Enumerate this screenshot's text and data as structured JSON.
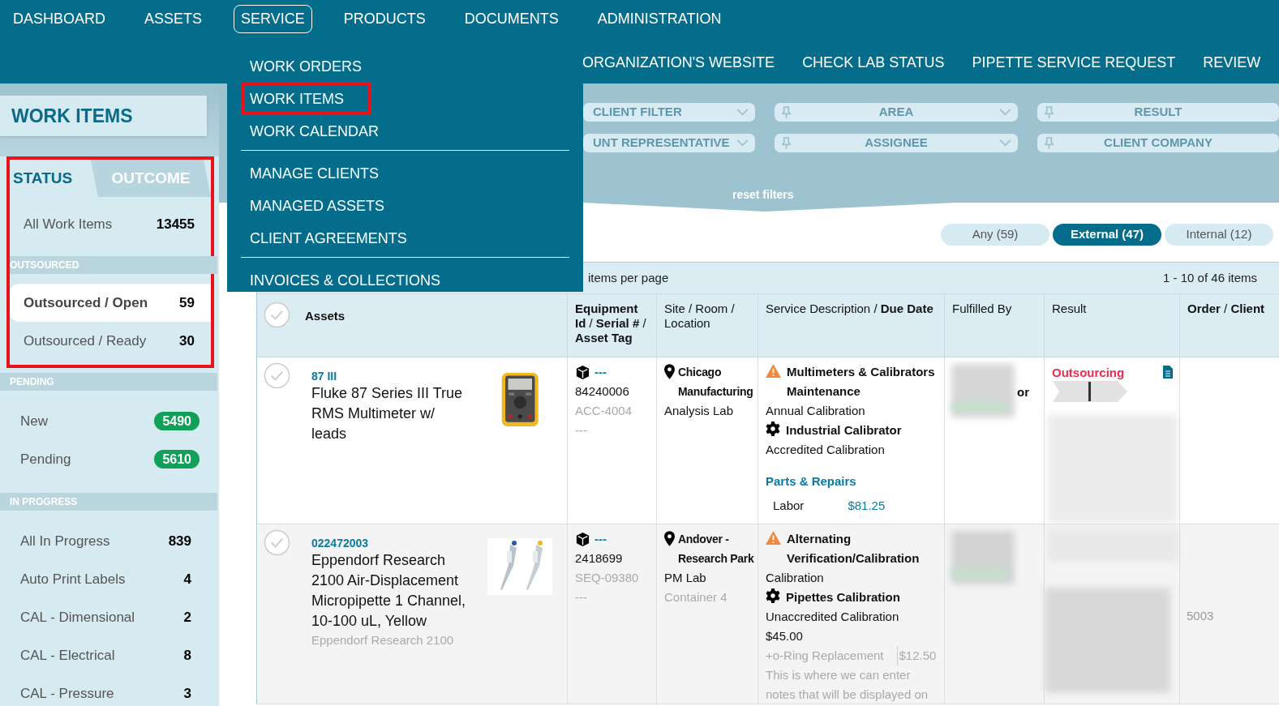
{
  "top_nav": [
    {
      "label": "DASHBOARD",
      "selected": false
    },
    {
      "label": "ASSETS",
      "selected": false
    },
    {
      "label": "SERVICE",
      "selected": true
    },
    {
      "label": "PRODUCTS",
      "selected": false
    },
    {
      "label": "DOCUMENTS",
      "selected": false
    },
    {
      "label": "ADMINISTRATION",
      "selected": false
    }
  ],
  "secondary_nav": [
    "ORGANIZATION'S WEBSITE",
    "CHECK LAB STATUS",
    "PIPETTE SERVICE REQUEST",
    "REVIEW"
  ],
  "service_menu": [
    {
      "items": [
        {
          "label": "WORK ORDERS",
          "highlighted": false
        },
        {
          "label": "WORK ITEMS",
          "highlighted": true
        },
        {
          "label": "WORK CALENDAR",
          "highlighted": false
        }
      ]
    },
    {
      "items": [
        {
          "label": "MANAGE CLIENTS",
          "highlighted": false
        },
        {
          "label": "MANAGED ASSETS",
          "highlighted": false
        },
        {
          "label": "CLIENT AGREEMENTS",
          "highlighted": false
        }
      ]
    },
    {
      "items": [
        {
          "label": "INVOICES & COLLECTIONS",
          "highlighted": false
        }
      ]
    }
  ],
  "page_title": "WORK ITEMS",
  "sidebar": {
    "tabs": [
      {
        "label": "STATUS",
        "selected": true
      },
      {
        "label": "OUTCOME",
        "selected": false
      }
    ],
    "sections": [
      {
        "highlighted": true,
        "items": [
          {
            "label": "All Work Items",
            "count": "13455",
            "kind": "plain",
            "selected": false
          }
        ]
      },
      {
        "header": "OUTSOURCED",
        "highlighted": true,
        "items": [
          {
            "label": "Outsourced / Open",
            "count": "59",
            "kind": "plain",
            "selected": true
          },
          {
            "label": "Outsourced / Ready",
            "count": "30",
            "kind": "plain",
            "selected": false
          }
        ]
      },
      {
        "header": "PENDING",
        "highlighted": false,
        "items": [
          {
            "label": "New",
            "count": "5490",
            "kind": "badge",
            "selected": false
          },
          {
            "label": "Pending",
            "count": "5610",
            "kind": "badge",
            "selected": false
          }
        ]
      },
      {
        "header": "IN PROGRESS",
        "highlighted": false,
        "items": [
          {
            "label": "All In Progress",
            "count": "839",
            "kind": "plain",
            "selected": false
          },
          {
            "label": "Auto Print Labels",
            "count": "4",
            "kind": "plain",
            "selected": false
          },
          {
            "label": "CAL - Dimensional",
            "count": "2",
            "kind": "plain",
            "selected": false
          },
          {
            "label": "CAL - Electrical",
            "count": "8",
            "kind": "plain",
            "selected": false
          },
          {
            "label": "CAL - Pressure",
            "count": "3",
            "kind": "plain",
            "selected": false
          }
        ]
      }
    ]
  },
  "filters": [
    {
      "label": "CLIENT FILTER",
      "pinned": false,
      "dropdown": true
    },
    {
      "label": "AREA",
      "pinned": true,
      "dropdown": true
    },
    {
      "label": "RESULT",
      "pinned": true,
      "dropdown": false
    },
    {
      "label": "UNT REPRESENTATIVE",
      "pinned": false,
      "dropdown": true
    },
    {
      "label": "ASSIGNEE",
      "pinned": true,
      "dropdown": true
    },
    {
      "label": "CLIENT COMPANY",
      "pinned": true,
      "dropdown": false
    }
  ],
  "reset_filters": "reset filters",
  "scope_buttons": [
    {
      "label": "Any (59)",
      "selected": false
    },
    {
      "label": "External (47)",
      "selected": true
    },
    {
      "label": "Internal (12)",
      "selected": false
    }
  ],
  "pager": {
    "label": "items per page",
    "range": "1 - 10 of 46 items"
  },
  "table": {
    "all_checked": false,
    "columns": [
      {
        "label": "Assets",
        "bold": true
      },
      {
        "label": "**Equipment Id** / **Serial #** / **Asset Tag**",
        "bold": false
      },
      {
        "label": "Site / Room / Location",
        "bold": false
      },
      {
        "label": "Service Description / **Due Date**",
        "bold": false
      },
      {
        "label": "Fulfilled By",
        "bold": false
      },
      {
        "label": "Result",
        "bold": false
      },
      {
        "label": "**Order** / **Client**",
        "bold": false
      }
    ],
    "rows": [
      {
        "checked": false,
        "asset_id": "87 III",
        "asset_name": "Fluke 87 Series III True RMS Multimeter w/ leads",
        "equipment": {
          "id": "---",
          "serial": "84240006",
          "tag": "ACC-4004",
          "extra": "---"
        },
        "site": {
          "name": "Chicago Manufacturing",
          "room": "Analysis Lab"
        },
        "service": [
          {
            "kind": "category",
            "text": "Multimeters & Calibrators Maintenance"
          },
          {
            "kind": "text",
            "text": "Annual Calibration"
          },
          {
            "kind": "service",
            "text": "Industrial Calibrator"
          },
          {
            "kind": "text",
            "text": "Accredited Calibration"
          },
          {
            "kind": "section",
            "text": "Parts & Repairs"
          },
          {
            "kind": "charge",
            "text": "Labor",
            "amount": "$81.25"
          }
        ],
        "fulfilled_by": "or",
        "result": {
          "label": "Outsourcing",
          "document": true
        }
      },
      {
        "checked": false,
        "asset_id": "022472003",
        "asset_name": "Eppendorf Research 2100 Air-Displacement Micropipette 1 Channel, 10-100 uL, Yellow",
        "asset_model": "Eppendorf Research 2100",
        "equipment": {
          "id": "---",
          "serial": "2418699",
          "tag": "SEQ-09380",
          "extra": "---"
        },
        "site": {
          "name": "Andover - Research Park",
          "room": "PM Lab",
          "location": "Container 4"
        },
        "service": [
          {
            "kind": "category",
            "text": "Alternating Verification/Calibration"
          },
          {
            "kind": "text",
            "text": "Calibration"
          },
          {
            "kind": "service",
            "text": "Pipettes Calibration"
          },
          {
            "kind": "text",
            "text": "Unaccredited Calibration"
          },
          {
            "kind": "text",
            "text": "$45.00"
          },
          {
            "kind": "addon",
            "text": "+o-Ring Replacement",
            "amount": "$12.50"
          },
          {
            "kind": "note",
            "text": "This is where we can enter notes that will be displayed on"
          }
        ],
        "order": "5003"
      }
    ]
  }
}
